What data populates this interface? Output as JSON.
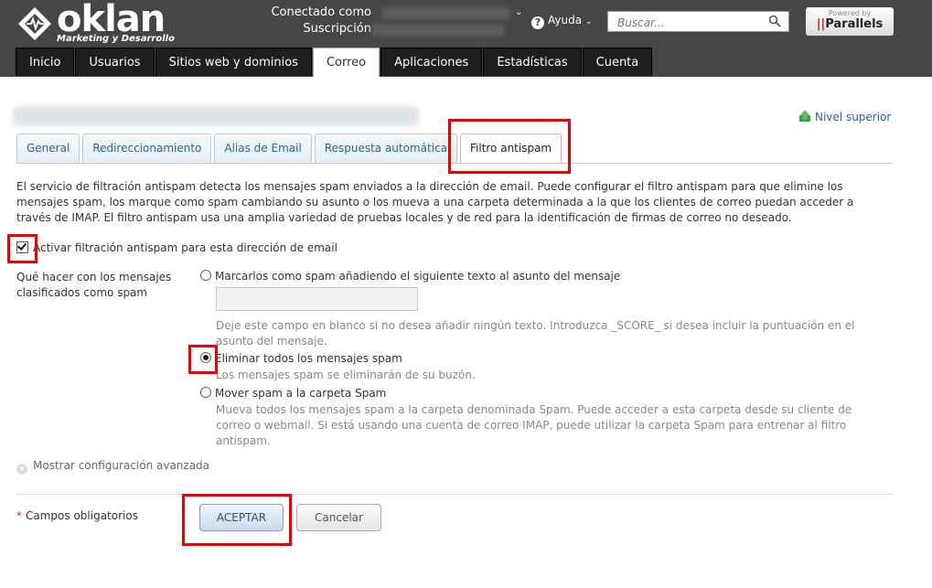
{
  "app": {
    "brand_word": "oklan",
    "brand_sub": "Marketing y Desarrollo",
    "connected_label": "Conectado como",
    "subscription_label": "Suscripción",
    "help_label": "Ayuda",
    "search_placeholder": "Buscar...",
    "powered_by": "Powered by",
    "parallels": "Parallels"
  },
  "nav": {
    "tabs": [
      {
        "label": "Inicio"
      },
      {
        "label": "Usuarios"
      },
      {
        "label": "Sitios web y dominios"
      },
      {
        "label": "Correo",
        "active": true
      },
      {
        "label": "Aplicaciones"
      },
      {
        "label": "Estadísticas"
      },
      {
        "label": "Cuenta"
      }
    ]
  },
  "page": {
    "up_level": "Nivel superior",
    "tabs": [
      {
        "label": "General"
      },
      {
        "label": "Redireccionamiento"
      },
      {
        "label": "Alias de Email"
      },
      {
        "label": "Respuesta automática"
      },
      {
        "label": "Filtro antispam",
        "active": true
      }
    ],
    "description": "El servicio de filtración antispam detecta los mensajes spam enviados a la dirección de email. Puede configurar el filtro antispam para que elimine los mensajes spam, los marque como spam cambiando su asunto o los mueva a una carpeta determinada a la que los clientes de correo puedan acceder a través de IMAP. El filtro antispam usa una amplia variedad de pruebas locales y de red para la identificación de firmas de correo no deseado.",
    "enable_label": "Activar filtración antispam para esta dirección de email",
    "enable_checked": true,
    "action_label": "Qué hacer con los mensajes clasificados como spam",
    "options": {
      "mark": {
        "label": "Marcarlos como spam añadiendo el siguiente texto al asunto del mensaje",
        "input_value": "",
        "hint": "Deje este campo en blanco si no desea añadir ningún texto. Introduzca _SCORE_ si desea incluir la puntuación en el asunto del mensaje."
      },
      "delete": {
        "label": "Eliminar todos los mensajes spam",
        "hint": "Los mensajes spam se eliminarán de su buzón.",
        "selected": true
      },
      "move": {
        "label": "Mover spam a la carpeta Spam",
        "hint": "Mueva todos los mensajes spam a la carpeta denominada Spam. Puede acceder a esta carpeta desde su cliente de correo o webmail. Si está usando una cuenta de correo IMAP, puede utilizar la carpeta Spam para entrenar al filtro antispam."
      }
    },
    "advanced_label": "Mostrar configuración avanzada",
    "required_star": "*",
    "required_label": "Campos obligatorios",
    "ok_label": "ACEPTAR",
    "cancel_label": "Cancelar"
  },
  "colors": {
    "header_bg": "#464646",
    "link": "#2a6496",
    "highlight": "#e00000"
  }
}
